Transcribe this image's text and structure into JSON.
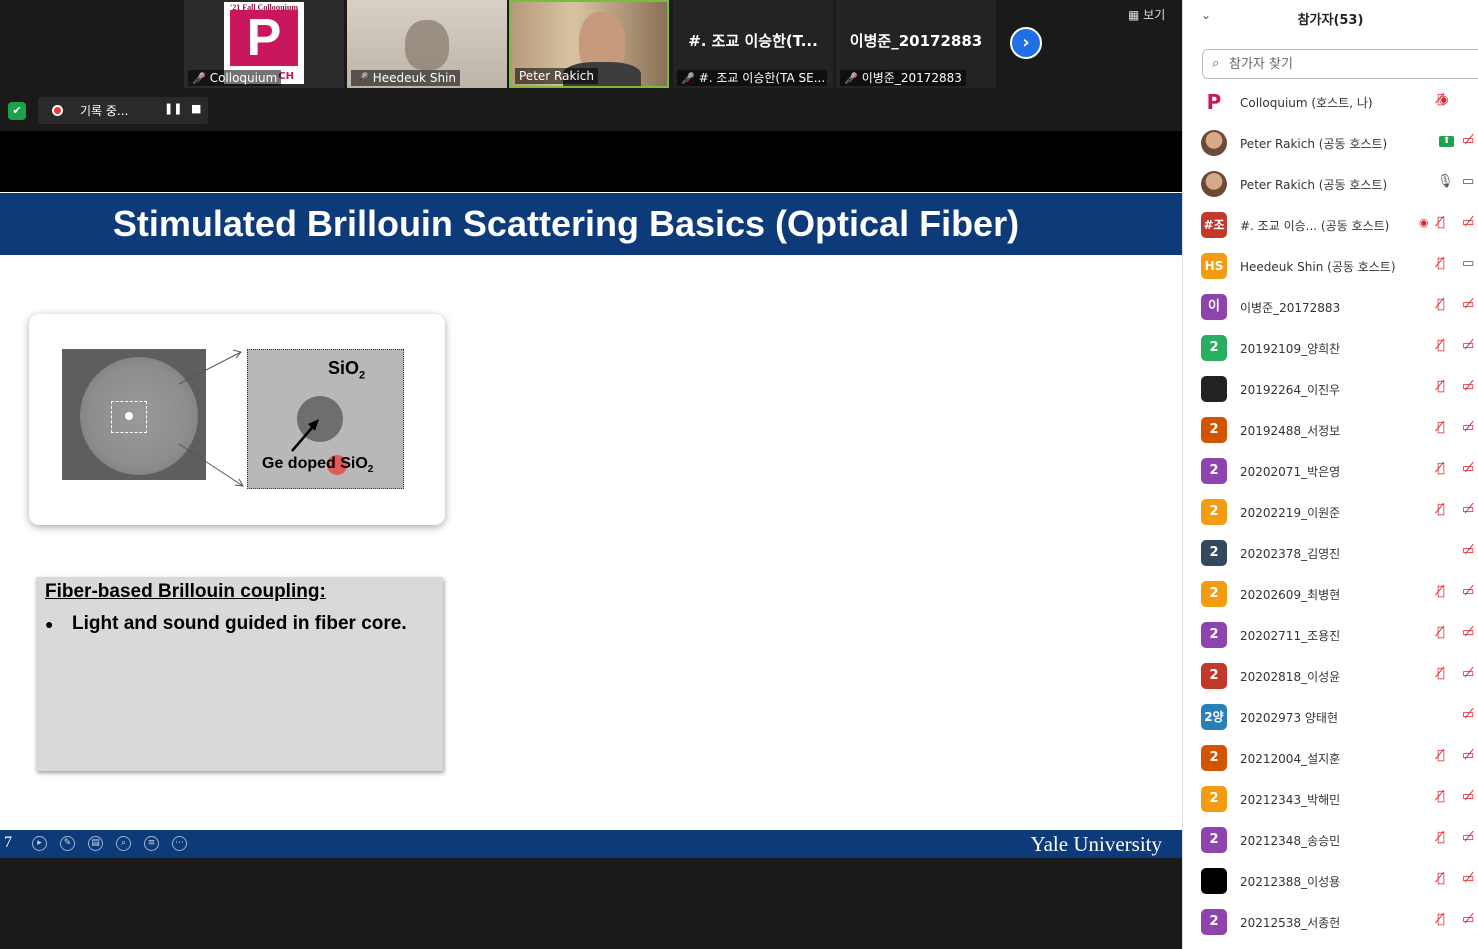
{
  "video_tiles": [
    {
      "name": "Colloquium",
      "logo_caption": "'21 Fall Colloquium",
      "logo_letters": "P",
      "logo_extra": "CH",
      "muted": true
    },
    {
      "name": "Heedeuk Shin",
      "muted": true
    },
    {
      "name": "Peter Rakich",
      "muted": false
    },
    {
      "name": "#. 조교 이승한(TA SE...",
      "big_label": "#. 조교 이승한(T...",
      "muted": true
    },
    {
      "name": "이병준_20172883",
      "big_label": "이병준_20172883",
      "muted": true
    }
  ],
  "view_label": "보기",
  "next_icon": "chevron-right-icon",
  "recording": {
    "label": "기록 중...",
    "pause": "❚❚",
    "stop": "■"
  },
  "slide": {
    "title": "Stimulated Brillouin Scattering Basics (Optical Fiber)",
    "sio2_label": "SiO",
    "sio2_sub": "2",
    "ge_label": "Ge doped SiO",
    "ge_sub": "2",
    "info_heading": "Fiber-based Brillouin coupling:",
    "info_bullet": "Light and sound guided in fiber core.",
    "slide_number": "7",
    "footer_brand": "Yale University",
    "colors": {
      "title_bar": "#0d3a78",
      "info_box": "#d9d9d9"
    }
  },
  "panel": {
    "title": "참가자(53)",
    "search_placeholder": "참가자 찾기",
    "participants": [
      {
        "name": "Colloquium (호스트, 나)",
        "avatar": "P",
        "avatar_color": "#ffffff",
        "icons": [
          "record",
          "mic-muted"
        ]
      },
      {
        "name": "Peter Rakich (공동 호스트)",
        "avatar": "photo",
        "avatar_color": "#b07a5a",
        "icons": [
          "share",
          "cam-off"
        ]
      },
      {
        "name": "Peter Rakich (공동 호스트)",
        "avatar": "photo",
        "avatar_color": "#b07a5a",
        "icons": [
          "mic-on",
          "cam-on"
        ]
      },
      {
        "name": "#. 조교 이승...  (공동 호스트)",
        "avatar": "#조",
        "avatar_color": "#c0392b",
        "icons": [
          "record",
          "mic-muted",
          "cam-off"
        ]
      },
      {
        "name": "Heedeuk Shin (공동 호스트)",
        "avatar": "HS",
        "avatar_color": "#f39c12",
        "icons": [
          "mic-muted",
          "cam-on"
        ]
      },
      {
        "name": " 이병준_20172883",
        "avatar": "이",
        "avatar_color": "#8e44ad",
        "icons": [
          "mic-muted",
          "cam-off"
        ]
      },
      {
        "name": "20192109_양희찬",
        "avatar": "2",
        "avatar_color": "#27ae60",
        "icons": [
          "mic-muted",
          "cam-off"
        ]
      },
      {
        "name": "20192264_이진우",
        "avatar": "",
        "avatar_color": "#222222",
        "icons": [
          "mic-muted",
          "cam-off"
        ]
      },
      {
        "name": "20192488_서정보",
        "avatar": "2",
        "avatar_color": "#d35400",
        "icons": [
          "mic-muted",
          "cam-off"
        ]
      },
      {
        "name": "20202071_박은영",
        "avatar": "2",
        "avatar_color": "#8e44ad",
        "icons": [
          "mic-muted",
          "cam-off"
        ]
      },
      {
        "name": "20202219_이원준",
        "avatar": "2",
        "avatar_color": "#f39c12",
        "icons": [
          "mic-muted",
          "cam-off"
        ]
      },
      {
        "name": "20202378_김영진",
        "avatar": "2",
        "avatar_color": "#34495e",
        "icons": [
          "cam-off"
        ]
      },
      {
        "name": "20202609_최병현",
        "avatar": "2",
        "avatar_color": "#f39c12",
        "icons": [
          "mic-muted",
          "cam-off"
        ]
      },
      {
        "name": "20202711_조용진",
        "avatar": "2",
        "avatar_color": "#8e44ad",
        "icons": [
          "mic-muted",
          "cam-off"
        ]
      },
      {
        "name": "20202818_이성윤",
        "avatar": "2",
        "avatar_color": "#c0392b",
        "icons": [
          "mic-muted",
          "cam-off"
        ]
      },
      {
        "name": "20202973 양태현",
        "avatar": "2양",
        "avatar_color": "#2980b9",
        "icons": [
          "cam-off"
        ]
      },
      {
        "name": "20212004_설지훈",
        "avatar": "2",
        "avatar_color": "#d35400",
        "icons": [
          "mic-muted",
          "cam-off"
        ]
      },
      {
        "name": "20212343_박해민",
        "avatar": "2",
        "avatar_color": "#f39c12",
        "icons": [
          "mic-muted",
          "cam-off"
        ]
      },
      {
        "name": "20212348_송승민",
        "avatar": "2",
        "avatar_color": "#8e44ad",
        "icons": [
          "mic-muted",
          "cam-off"
        ]
      },
      {
        "name": "20212388_이성용",
        "avatar": "",
        "avatar_color": "#000000",
        "icons": [
          "mic-muted",
          "cam-off"
        ]
      },
      {
        "name": "20212538_서종헌",
        "avatar": "2",
        "avatar_color": "#8e44ad",
        "icons": [
          "mic-muted",
          "cam-off"
        ]
      }
    ]
  }
}
